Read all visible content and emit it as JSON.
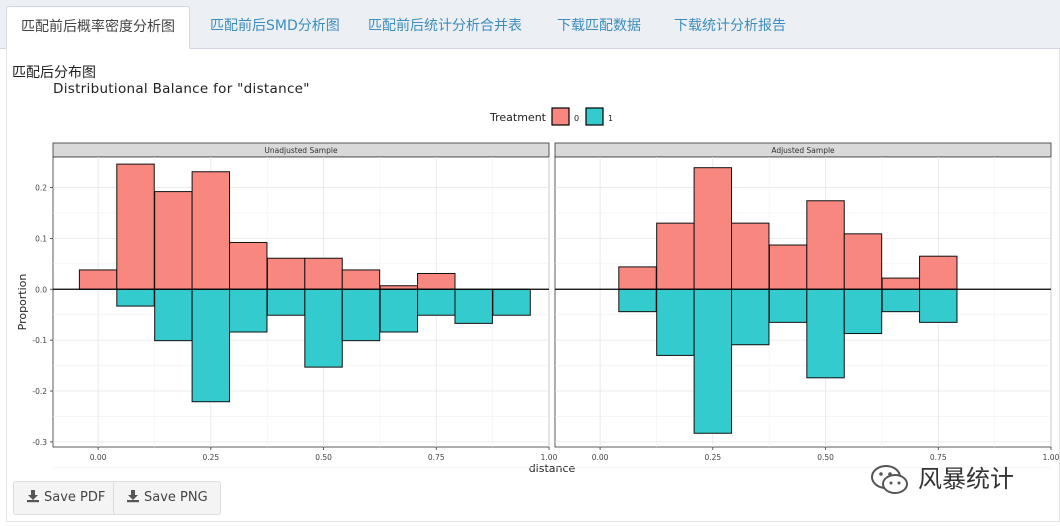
{
  "tabs": [
    {
      "label": "匹配前后概率密度分析图",
      "active": true
    },
    {
      "label": "匹配前后SMD分析图",
      "active": false
    },
    {
      "label": "匹配前后统计分析合并表",
      "active": false
    },
    {
      "label": "下载匹配数据",
      "active": false
    },
    {
      "label": "下载统计分析报告",
      "active": false
    }
  ],
  "section_title": "匹配后分布图",
  "buttons": {
    "save_pdf": "Save PDF",
    "save_png": "Save PNG"
  },
  "watermark": "风暴统计",
  "icons": {
    "download": "download-icon",
    "watermark": "wechat-icon"
  },
  "colors": {
    "treatment_0": "#f8877f",
    "treatment_1": "#33cbce",
    "tab_link": "#3c8dbc"
  },
  "chart_data": {
    "type": "bar",
    "title": "Distributional Balance for \"distance\"",
    "xlabel": "distance",
    "ylabel": "Proportion",
    "legend": {
      "title": "Treatment",
      "entries": [
        "0",
        "1"
      ],
      "placement": "top"
    },
    "xlim": [
      -0.1,
      1.0
    ],
    "xticks": [
      "0.00",
      "0.25",
      "0.50",
      "0.75",
      "1.00"
    ],
    "ylim": [
      -0.31,
      0.26
    ],
    "yticks": [
      "-0.3",
      "-0.2",
      "-0.1",
      "0.0",
      "0.1",
      "0.2"
    ],
    "grid": true,
    "bin_width": 0.083,
    "panels": [
      {
        "name": "Unadjusted Sample",
        "bin_centers": [
          0.0,
          0.083,
          0.167,
          0.25,
          0.333,
          0.417,
          0.5,
          0.583,
          0.667,
          0.75,
          0.833,
          0.917
        ],
        "series": [
          {
            "name": "0",
            "values": [
              0.038,
              0.246,
              0.192,
              0.231,
              0.092,
              0.061,
              0.061,
              0.038,
              0.007,
              0.031,
              null,
              null
            ]
          },
          {
            "name": "1",
            "values": [
              null,
              -0.033,
              -0.101,
              -0.221,
              -0.084,
              -0.051,
              -0.153,
              -0.101,
              -0.084,
              -0.051,
              -0.067,
              -0.051
            ]
          }
        ]
      },
      {
        "name": "Adjusted Sample",
        "bin_centers": [
          0.083,
          0.167,
          0.25,
          0.333,
          0.417,
          0.5,
          0.583,
          0.667,
          0.75
        ],
        "series": [
          {
            "name": "0",
            "values": [
              0.044,
              0.13,
              0.239,
              0.13,
              0.087,
              0.174,
              0.109,
              0.022,
              0.065
            ]
          },
          {
            "name": "1",
            "values": [
              -0.044,
              -0.13,
              -0.283,
              -0.109,
              -0.065,
              -0.174,
              -0.087,
              -0.044,
              -0.065
            ]
          }
        ]
      }
    ]
  }
}
